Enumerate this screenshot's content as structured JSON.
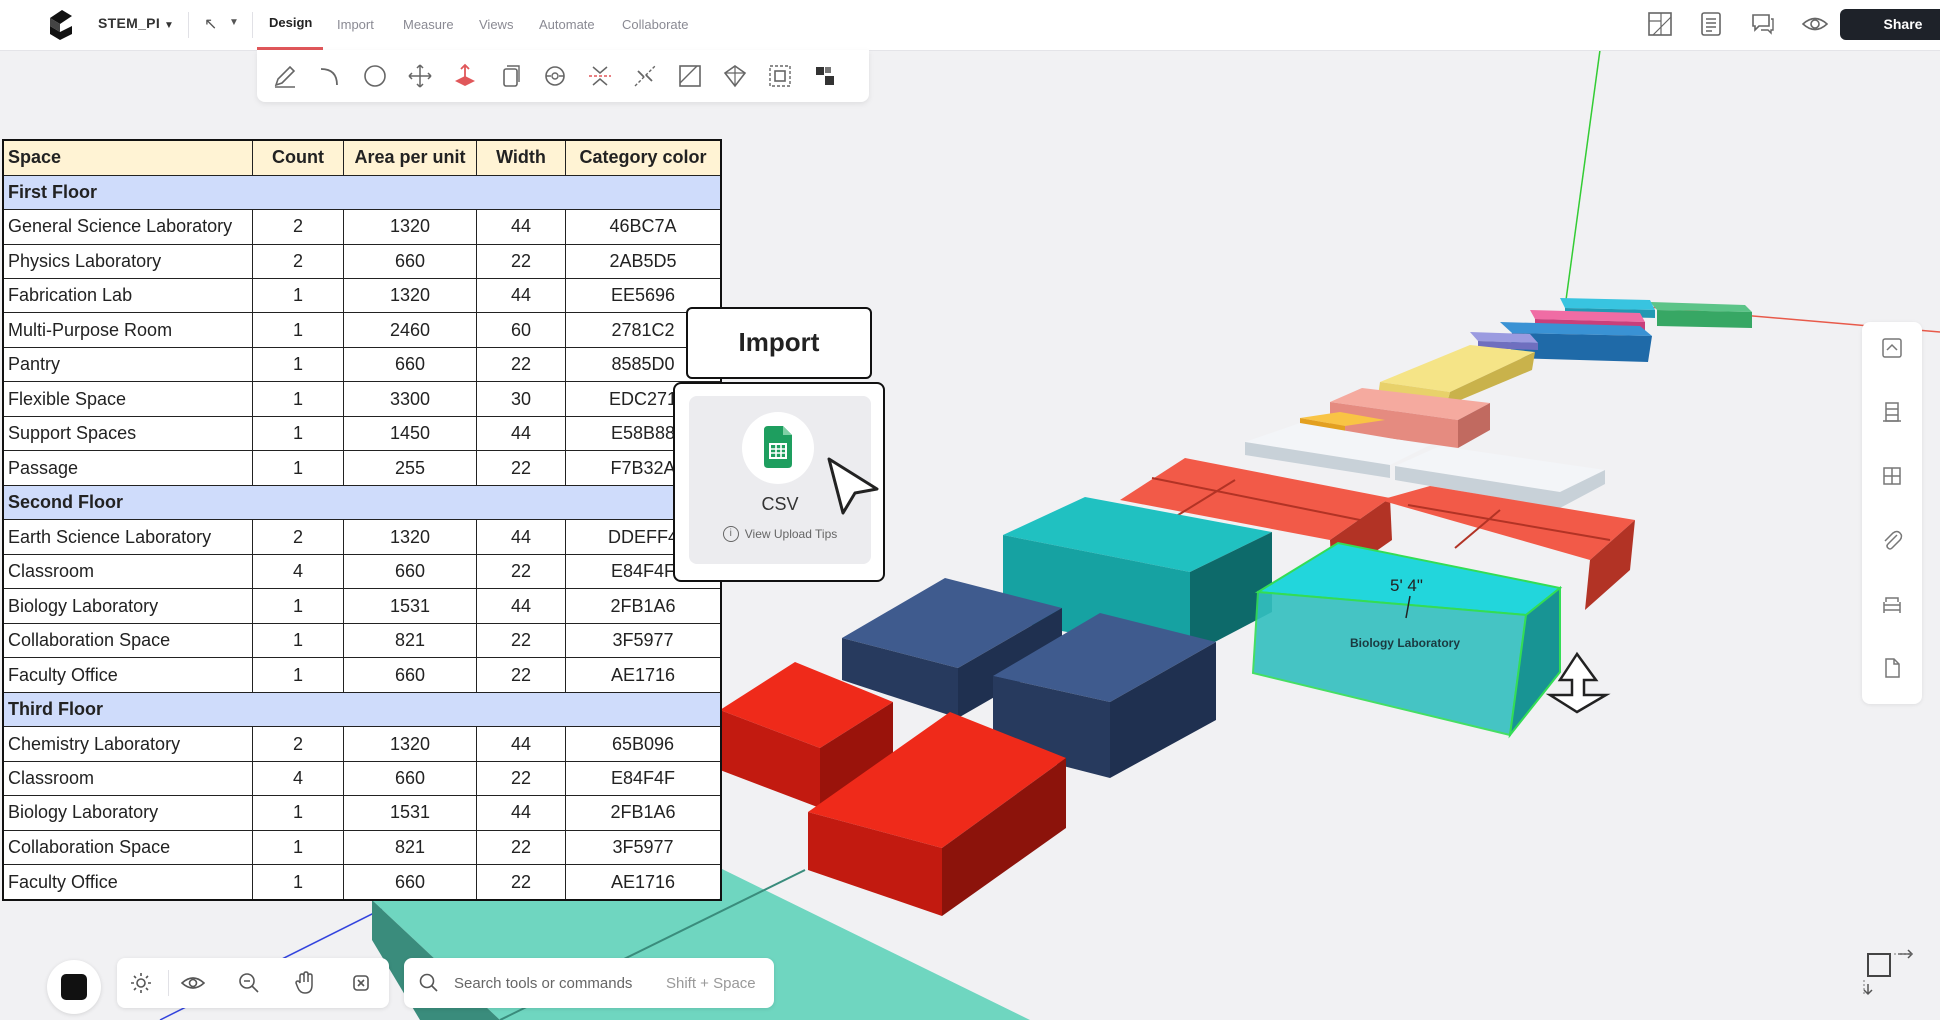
{
  "header": {
    "project_name": "STEM_PI",
    "nav_tabs": [
      "Design",
      "Import",
      "Measure",
      "Views",
      "Automate",
      "Collaborate"
    ],
    "share_label": "Share"
  },
  "schedule_table": {
    "columns": [
      "Space",
      "Count",
      "Area per unit",
      "Width",
      "Category color"
    ],
    "floors": [
      {
        "name": "First Floor",
        "rows": [
          [
            "General Science Laboratory",
            "2",
            "1320",
            "44",
            "46BC7A"
          ],
          [
            "Physics Laboratory",
            "2",
            "660",
            "22",
            "2AB5D5"
          ],
          [
            "Fabrication Lab",
            "1",
            "1320",
            "44",
            "EE5696"
          ],
          [
            "Multi-Purpose Room",
            "1",
            "2460",
            "60",
            "2781C2"
          ],
          [
            "Pantry",
            "1",
            "660",
            "22",
            "8585D0"
          ],
          [
            "Flexible Space",
            "1",
            "3300",
            "30",
            "EDC271"
          ],
          [
            "Support Spaces",
            "1",
            "1450",
            "44",
            "E58B88"
          ],
          [
            "Passage",
            "1",
            "255",
            "22",
            "F7B32A"
          ]
        ]
      },
      {
        "name": "Second Floor",
        "rows": [
          [
            "Earth Science Laboratory",
            "2",
            "1320",
            "44",
            "DDEFF4"
          ],
          [
            "Classroom",
            "4",
            "660",
            "22",
            "E84F4F"
          ],
          [
            "Biology Laboratory",
            "1",
            "1531",
            "44",
            "2FB1A6"
          ],
          [
            "Collaboration Space",
            "1",
            "821",
            "22",
            "3F5977"
          ],
          [
            "Faculty Office",
            "1",
            "660",
            "22",
            "AE1716"
          ]
        ]
      },
      {
        "name": "Third Floor",
        "rows": [
          [
            "Chemistry Laboratory",
            "2",
            "1320",
            "44",
            "65B096"
          ],
          [
            "Classroom",
            "4",
            "660",
            "22",
            "E84F4F"
          ],
          [
            "Biology Laboratory",
            "1",
            "1531",
            "44",
            "2FB1A6"
          ],
          [
            "Collaboration Space",
            "1",
            "821",
            "22",
            "3F5977"
          ],
          [
            "Faculty Office",
            "1",
            "660",
            "22",
            "AE1716"
          ]
        ]
      }
    ]
  },
  "import_panel": {
    "title": "Import",
    "csv_label": "CSV",
    "tips_label": "View Upload Tips"
  },
  "viewport": {
    "dimension_label": "5' 4\"",
    "selected_block_label": "Biology Laboratory"
  },
  "search": {
    "placeholder": "Search tools or commands",
    "shortcut": "Shift + Space"
  },
  "colors": {
    "accent": "#e0575a",
    "floor_row": "#cfdcfb",
    "header_row": "#fff3d4",
    "share_bg": "#1e2229"
  }
}
